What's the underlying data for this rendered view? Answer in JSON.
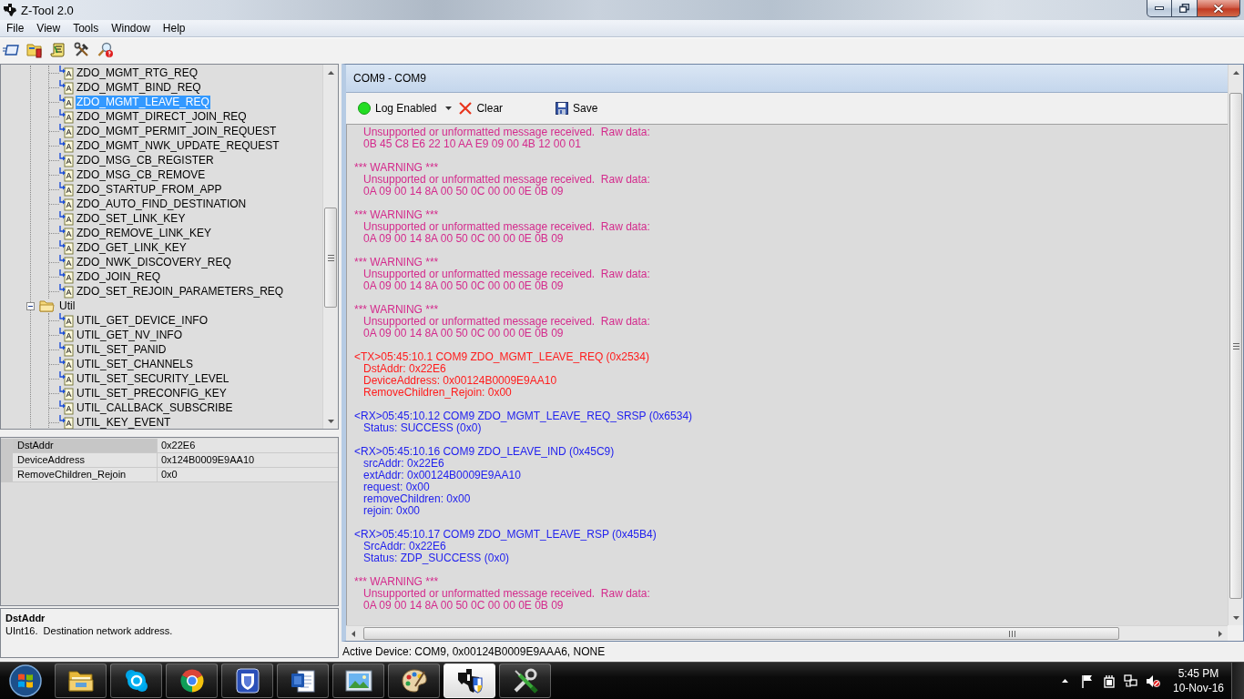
{
  "window": {
    "title": "Z-Tool 2.0"
  },
  "menu": [
    {
      "label": "File"
    },
    {
      "label": "View"
    },
    {
      "label": "Tools"
    },
    {
      "label": "Window"
    },
    {
      "label": "Help"
    }
  ],
  "tree": {
    "groups": [
      {
        "children": [
          {
            "label": "ZDO_MGMT_RTG_REQ",
            "selected": false
          },
          {
            "label": "ZDO_MGMT_BIND_REQ",
            "selected": false
          },
          {
            "label": "ZDO_MGMT_LEAVE_REQ",
            "selected": true
          },
          {
            "label": "ZDO_MGMT_DIRECT_JOIN_REQ",
            "selected": false
          },
          {
            "label": "ZDO_MGMT_PERMIT_JOIN_REQUEST",
            "selected": false
          },
          {
            "label": "ZDO_MGMT_NWK_UPDATE_REQUEST",
            "selected": false
          },
          {
            "label": "ZDO_MSG_CB_REGISTER",
            "selected": false
          },
          {
            "label": "ZDO_MSG_CB_REMOVE",
            "selected": false
          },
          {
            "label": "ZDO_STARTUP_FROM_APP",
            "selected": false
          },
          {
            "label": "ZDO_AUTO_FIND_DESTINATION",
            "selected": false
          },
          {
            "label": "ZDO_SET_LINK_KEY",
            "selected": false
          },
          {
            "label": "ZDO_REMOVE_LINK_KEY",
            "selected": false
          },
          {
            "label": "ZDO_GET_LINK_KEY",
            "selected": false
          },
          {
            "label": "ZDO_NWK_DISCOVERY_REQ",
            "selected": false
          },
          {
            "label": "ZDO_JOIN_REQ",
            "selected": false
          },
          {
            "label": "ZDO_SET_REJOIN_PARAMETERS_REQ",
            "selected": false
          }
        ]
      },
      {
        "label": "Util",
        "expanded": true,
        "selected": false,
        "children": [
          {
            "label": "UTIL_GET_DEVICE_INFO",
            "selected": false
          },
          {
            "label": "UTIL_GET_NV_INFO",
            "selected": false
          },
          {
            "label": "UTIL_SET_PANID",
            "selected": false
          },
          {
            "label": "UTIL_SET_CHANNELS",
            "selected": false
          },
          {
            "label": "UTIL_SET_SECURITY_LEVEL",
            "selected": false
          },
          {
            "label": "UTIL_SET_PRECONFIG_KEY",
            "selected": false
          },
          {
            "label": "UTIL_CALLBACK_SUBSCRIBE",
            "selected": false
          },
          {
            "label": "UTIL_KEY_EVENT",
            "selected": false
          }
        ]
      }
    ]
  },
  "properties": {
    "rows": [
      {
        "name": "DstAddr",
        "value": "0x22E6",
        "selected": true
      },
      {
        "name": "DeviceAddress",
        "value": "0x124B0009E9AA10",
        "selected": false
      },
      {
        "name": "RemoveChildren_Rejoin",
        "value": "0x0",
        "selected": false
      }
    ]
  },
  "description": {
    "title": "DstAddr",
    "text": "UInt16.  Destination network address."
  },
  "log_panel": {
    "title": "COM9 - COM9",
    "log_enabled": {
      "label": "Log Enabled",
      "on": true
    },
    "clear": {
      "label": "Clear"
    },
    "save": {
      "label": "Save"
    },
    "entries": [
      {
        "kind": "warning",
        "lines": [
          "Unsupported or unformatted message received.  Raw data:",
          "0B 45 C8 E6 22 10 AA E9 09 00 4B 12 00 01"
        ]
      },
      {
        "kind": "warning",
        "heading": "*** WARNING ***",
        "lines": [
          "Unsupported or unformatted message received.  Raw data:",
          "0A 09 00 14 8A 00 50 0C 00 00 0E 0B 09"
        ]
      },
      {
        "kind": "warning",
        "heading": "*** WARNING ***",
        "lines": [
          "Unsupported or unformatted message received.  Raw data:",
          "0A 09 00 14 8A 00 50 0C 00 00 0E 0B 09"
        ]
      },
      {
        "kind": "warning",
        "heading": "*** WARNING ***",
        "lines": [
          "Unsupported or unformatted message received.  Raw data:",
          "0A 09 00 14 8A 00 50 0C 00 00 0E 0B 09"
        ]
      },
      {
        "kind": "warning",
        "heading": "*** WARNING ***",
        "lines": [
          "Unsupported or unformatted message received.  Raw data:",
          "0A 09 00 14 8A 00 50 0C 00 00 0E 0B 09"
        ]
      },
      {
        "kind": "tx",
        "heading": "<TX>05:45:10.1 COM9 ZDO_MGMT_LEAVE_REQ (0x2534)",
        "lines": [
          "DstAddr: 0x22E6",
          "DeviceAddress: 0x00124B0009E9AA10",
          "RemoveChildren_Rejoin: 0x00"
        ]
      },
      {
        "kind": "rx",
        "heading": "<RX>05:45:10.12 COM9 ZDO_MGMT_LEAVE_REQ_SRSP (0x6534)",
        "lines": [
          "Status: SUCCESS (0x0)"
        ]
      },
      {
        "kind": "rx",
        "heading": "<RX>05:45:10.16 COM9 ZDO_LEAVE_IND (0x45C9)",
        "lines": [
          "srcAddr: 0x22E6",
          "extAddr: 0x00124B0009E9AA10",
          "request: 0x00",
          "removeChildren: 0x00",
          "rejoin: 0x00"
        ]
      },
      {
        "kind": "rx",
        "heading": "<RX>05:45:10.17 COM9 ZDO_MGMT_LEAVE_RSP (0x45B4)",
        "lines": [
          "SrcAddr: 0x22E6",
          "Status: ZDP_SUCCESS (0x0)"
        ]
      },
      {
        "kind": "warning",
        "heading": "*** WARNING ***",
        "lines": [
          "Unsupported or unformatted message received.  Raw data:",
          "0A 09 00 14 8A 00 50 0C 00 00 0E 0B 09"
        ]
      }
    ]
  },
  "status_bar": {
    "text": "Active Device: COM9, 0x00124B0009E9AAA6, NONE"
  },
  "taskbar": {
    "apps": [
      {
        "kind": "folder",
        "selected": false
      },
      {
        "kind": "bubble",
        "selected": false
      },
      {
        "kind": "ring",
        "selected": false
      },
      {
        "kind": "badge",
        "selected": false
      },
      {
        "kind": "document",
        "selected": false
      },
      {
        "kind": "picture",
        "selected": false
      },
      {
        "kind": "palette",
        "selected": false
      },
      {
        "kind": "emblem",
        "selected": true
      },
      {
        "kind": "tools",
        "selected": false
      }
    ],
    "clock": {
      "time": "5:45 PM",
      "date": "10-Nov-16"
    }
  }
}
